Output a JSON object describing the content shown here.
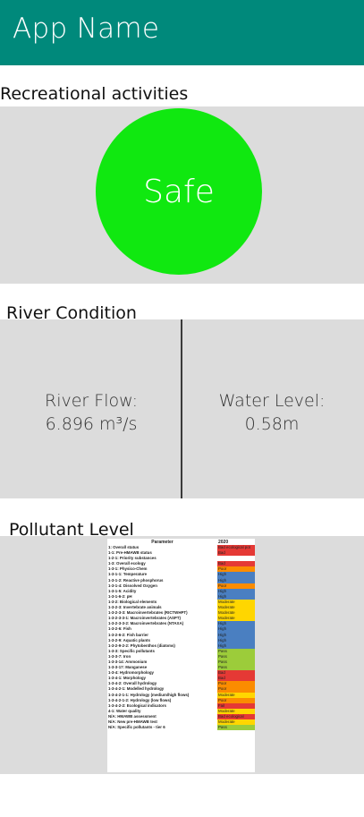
{
  "app": {
    "title": "App Name",
    "accent": "#00897b"
  },
  "recreation": {
    "title": "Recreational activities",
    "status": "Safe",
    "status_color": "#10e810"
  },
  "river": {
    "title": "River Condition",
    "flow_label": "River Flow:",
    "flow_value": "6.896 m³/s",
    "level_label": "Water Level:",
    "level_value": "0.58m"
  },
  "pollutant": {
    "title": "Pollutant Level",
    "table": {
      "header_param": "Parameter",
      "header_year": "2020",
      "status_colors": {
        "Bad": "#e53935",
        "Poor": "#fb8c00",
        "Moderate": "#ffd600",
        "High": "#4a7fc1",
        "Pass": "#9ccc3a",
        "Fail": "#e53935",
        "Bad ecological": "#e53935",
        "Bad ecological pot": "#e53935"
      },
      "rows": [
        {
          "param": "1: Overall status",
          "value": "Bad ecological pot"
        },
        {
          "param": "1-1: Pre-HMAWB status",
          "value": "Bad"
        },
        {
          "param": "1-2-1: Priority substances",
          "value": ""
        },
        {
          "param": "1-3: Overall ecology",
          "value": "Bad"
        },
        {
          "param": "1-3-1: Physico-Chem",
          "value": "Poor"
        },
        {
          "param": "1-3-1-1: Temperature",
          "value": "High"
        },
        {
          "param": "1-3-1-2: Reactive phosphorus",
          "value": "High"
        },
        {
          "param": "1-3-1-4: Dissolved Oxygen",
          "value": "Poor"
        },
        {
          "param": "1-3-1-5: Acidity",
          "value": "High"
        },
        {
          "param": "1-3-1-6-2: pH",
          "value": "High"
        },
        {
          "param": "1-3-2: Biological elements",
          "value": "Moderate"
        },
        {
          "param": "1-3-2-3: Invertebrate animals",
          "value": "Moderate"
        },
        {
          "param": "1-3-2-3-3: Macroinvertebrates (RICTWHPT)",
          "value": "Moderate"
        },
        {
          "param": "1-3-2-3-3-1: Macroinvertebrates (ASPT)",
          "value": "Moderate"
        },
        {
          "param": "1-3-2-3-3-2: Macroinvertebrates (NTAXA)",
          "value": "High"
        },
        {
          "param": "1-3-2-6: Fish",
          "value": "High"
        },
        {
          "param": "1-3-2-6-2: Fish barrier",
          "value": "High"
        },
        {
          "param": "1-3-2-9: Aquatic plants",
          "value": "High"
        },
        {
          "param": "1-3-2-9-2-2: Phytobenthos (diatoms)",
          "value": "High"
        },
        {
          "param": "1-3-3: Specific pollutants",
          "value": "Pass"
        },
        {
          "param": "1-3-3-7: Iron",
          "value": "Pass"
        },
        {
          "param": "1-3-3-14: Ammonium",
          "value": "Pass"
        },
        {
          "param": "1-3-3-17: Manganese",
          "value": "Pass"
        },
        {
          "param": "1-3-4: Hydromorphology",
          "value": "Bad"
        },
        {
          "param": "1-3-4-1: Morphology",
          "value": "Bad"
        },
        {
          "param": "1-3-4-2: Overall hydrology",
          "value": "Poor"
        },
        {
          "param": "1-3-4-2-1: Modelled hydrology",
          "value": "Poor"
        },
        {
          "param": "1-3-4-2-1-1: Hydrology (medium/high flows)",
          "value": "Moderate"
        },
        {
          "param": "1-3-4-2-1-2: Hydrology (low flows)",
          "value": "Poor"
        },
        {
          "param": "1-3-4-2-2: Ecological indicators",
          "value": "Fail"
        },
        {
          "param": "4-1: Water quality",
          "value": "Moderate"
        },
        {
          "param": "N/A: HMAWB assessment",
          "value": "Bad ecological"
        },
        {
          "param": "N/A: New pre-HMAWB test",
          "value": "Moderate"
        },
        {
          "param": "N/A: Specific pollutants - tier 6",
          "value": "Pass"
        }
      ]
    }
  }
}
